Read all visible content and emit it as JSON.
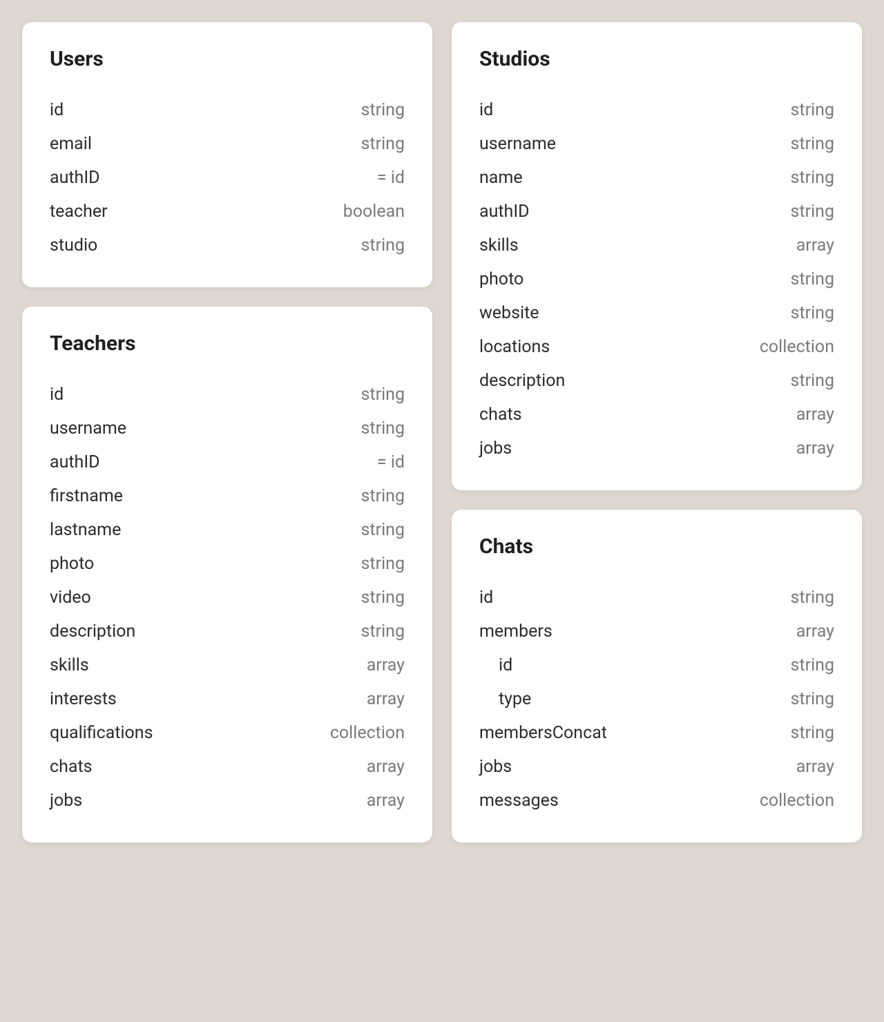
{
  "schemas": [
    {
      "title": "Users",
      "fields": [
        {
          "name": "id",
          "type": "string",
          "indent": false
        },
        {
          "name": "email",
          "type": "string",
          "indent": false
        },
        {
          "name": "authID",
          "type": "= id",
          "indent": false
        },
        {
          "name": "teacher",
          "type": "boolean",
          "indent": false
        },
        {
          "name": "studio",
          "type": "string",
          "indent": false
        }
      ]
    },
    {
      "title": "Teachers",
      "fields": [
        {
          "name": "id",
          "type": "string",
          "indent": false
        },
        {
          "name": "username",
          "type": "string",
          "indent": false
        },
        {
          "name": "authID",
          "type": "= id",
          "indent": false
        },
        {
          "name": "firstname",
          "type": "string",
          "indent": false
        },
        {
          "name": "lastname",
          "type": "string",
          "indent": false
        },
        {
          "name": "photo",
          "type": "string",
          "indent": false
        },
        {
          "name": "video",
          "type": "string",
          "indent": false
        },
        {
          "name": "description",
          "type": "string",
          "indent": false
        },
        {
          "name": "skills",
          "type": "array",
          "indent": false
        },
        {
          "name": "interests",
          "type": "array",
          "indent": false
        },
        {
          "name": "qualifications",
          "type": "collection",
          "indent": false
        },
        {
          "name": "chats",
          "type": "array",
          "indent": false
        },
        {
          "name": "jobs",
          "type": "array",
          "indent": false
        }
      ]
    },
    {
      "title": "Studios",
      "fields": [
        {
          "name": "id",
          "type": "string",
          "indent": false
        },
        {
          "name": "username",
          "type": "string",
          "indent": false
        },
        {
          "name": "name",
          "type": "string",
          "indent": false
        },
        {
          "name": "authID",
          "type": "string",
          "indent": false
        },
        {
          "name": "skills",
          "type": "array",
          "indent": false
        },
        {
          "name": "photo",
          "type": "string",
          "indent": false
        },
        {
          "name": "website",
          "type": "string",
          "indent": false
        },
        {
          "name": "locations",
          "type": "collection",
          "indent": false
        },
        {
          "name": "description",
          "type": "string",
          "indent": false
        },
        {
          "name": "chats",
          "type": "array",
          "indent": false
        },
        {
          "name": "jobs",
          "type": "array",
          "indent": false
        }
      ]
    },
    {
      "title": "Chats",
      "fields": [
        {
          "name": "id",
          "type": "string",
          "indent": false
        },
        {
          "name": "members",
          "type": "array",
          "indent": false
        },
        {
          "name": "id",
          "type": "string",
          "indent": true
        },
        {
          "name": "type",
          "type": "string",
          "indent": true
        },
        {
          "name": "membersConcat",
          "type": "string",
          "indent": false
        },
        {
          "name": "jobs",
          "type": "array",
          "indent": false
        },
        {
          "name": "messages",
          "type": "collection",
          "indent": false
        }
      ]
    }
  ],
  "layout": {
    "left": [
      0,
      1
    ],
    "right": [
      2,
      3
    ]
  }
}
